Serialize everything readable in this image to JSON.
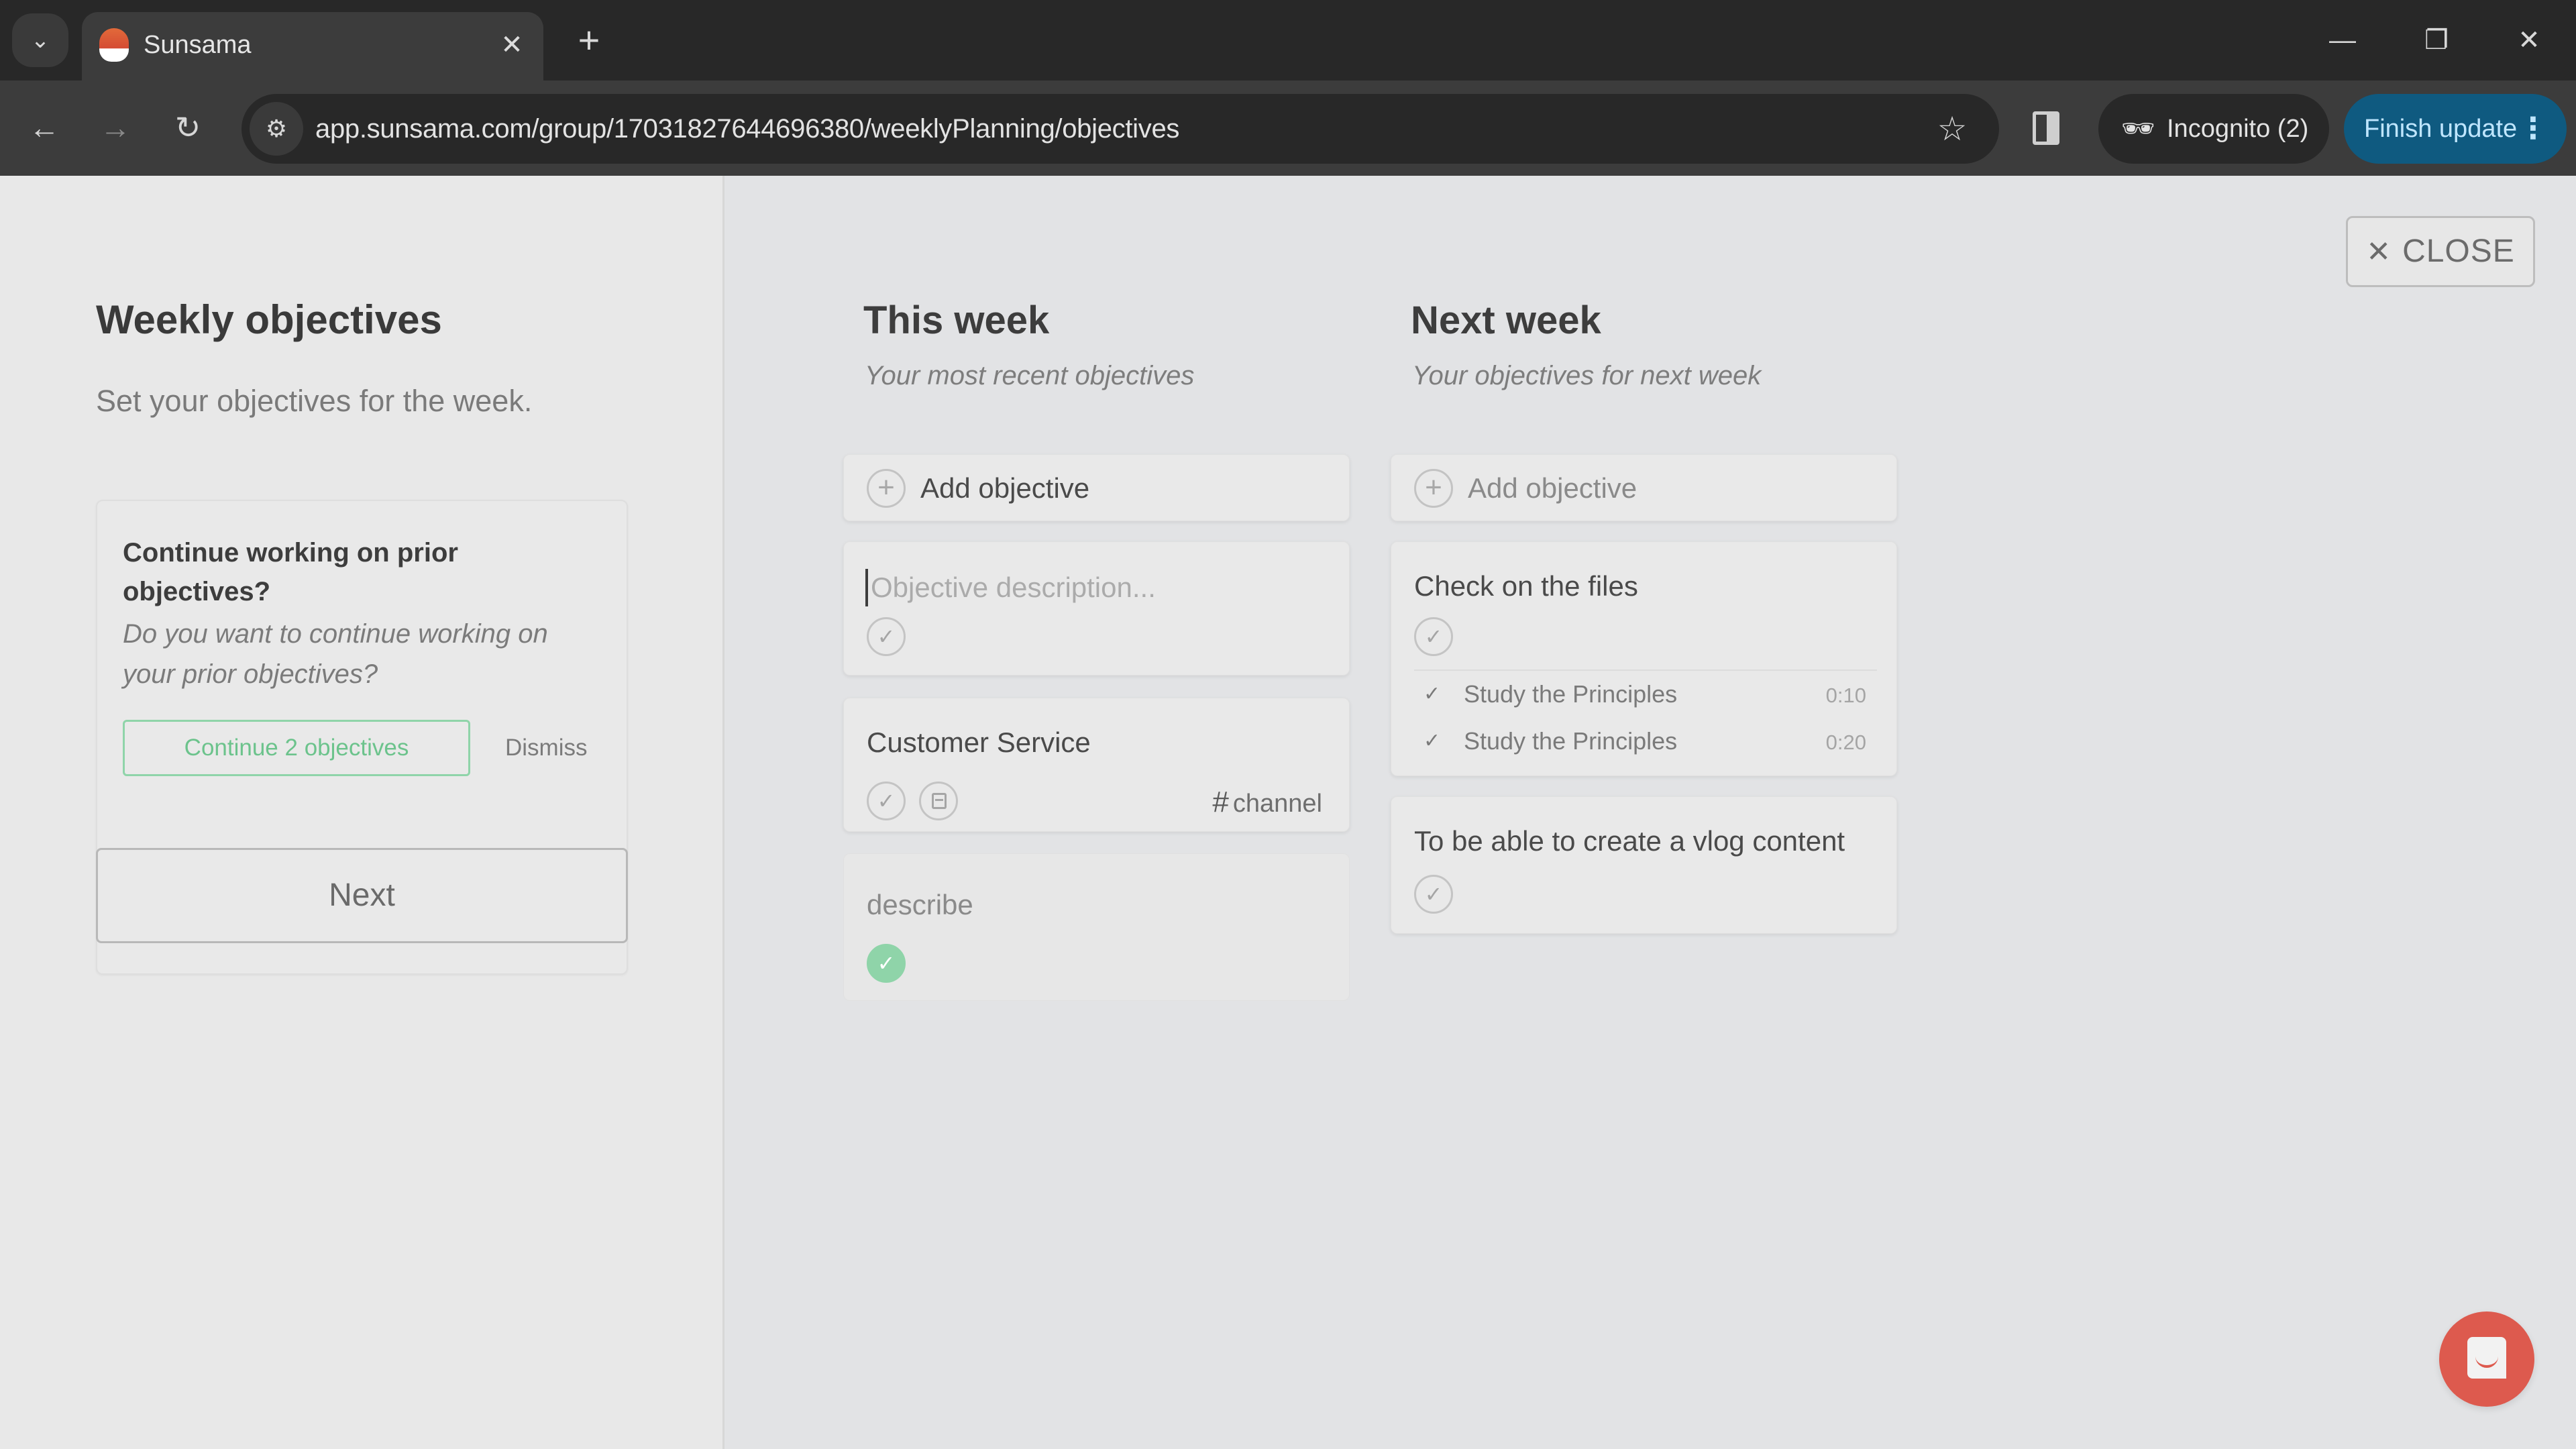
{
  "browser": {
    "tab_title": "Sunsama",
    "url": "app.sunsama.com/group/17031827644696380/weeklyPlanning/objectives",
    "incognito_label": "Incognito (2)",
    "finish_update_label": "Finish update",
    "icons": {
      "tab_search": "chevron-down-icon",
      "tab_close": "close-icon",
      "new_tab": "plus-icon",
      "minimize": "minimize-icon",
      "restore": "restore-icon",
      "window_close": "close-icon",
      "back": "arrow-left-icon",
      "forward": "arrow-right-icon",
      "reload": "reload-icon",
      "site_info": "tune-icon",
      "bookmark": "star-icon",
      "side_panel": "side-panel-icon",
      "incognito": "incognito-icon",
      "menu": "kebab-icon"
    },
    "glyphs": {
      "tab_search": "⌄",
      "tab_close": "✕",
      "new_tab": "+",
      "minimize": "—",
      "restore": "❐",
      "window_close": "✕",
      "back": "←",
      "forward": "→",
      "reload": "↻",
      "site_info": "⚙",
      "bookmark": "☆",
      "incognito": "🕶",
      "menu": "⋮"
    }
  },
  "left_panel": {
    "title": "Weekly objectives",
    "subtitle": "Set your objectives for the week.",
    "prior_card": {
      "title": "Continue working on prior objectives?",
      "description": "Do you want to continue working on your prior objectives?",
      "continue_label": "Continue 2 objectives",
      "dismiss_label": "Dismiss"
    },
    "next_label": "Next"
  },
  "close_button": {
    "glyph": "✕",
    "label": "CLOSE"
  },
  "this_week": {
    "title": "This week",
    "subtitle": "Your most recent objectives",
    "add_label": "Add objective",
    "add_glyph": "+",
    "new_objective_placeholder": "Objective description...",
    "objectives": [
      {
        "title": "Customer Service",
        "channel": "channel",
        "channel_prefix": "#",
        "completed": false
      },
      {
        "title": "describe",
        "completed": true
      }
    ]
  },
  "next_week": {
    "title": "Next week",
    "subtitle": "Your objectives for next week",
    "add_label": "Add objective",
    "add_glyph": "+",
    "objectives": [
      {
        "title": "Check on the files",
        "completed": false,
        "subtasks": [
          {
            "title": "Study the Principles",
            "time": "0:10",
            "done": true
          },
          {
            "title": "Study the Principles",
            "time": "0:20",
            "done": true
          }
        ]
      },
      {
        "title": "To be able to create a vlog content",
        "completed": false
      }
    ]
  },
  "glyphs": {
    "check": "✓"
  },
  "colors": {
    "accent_green": "#8fd4a9",
    "chat_red": "#dd5a4e",
    "update_blue": "#0f5a80"
  }
}
